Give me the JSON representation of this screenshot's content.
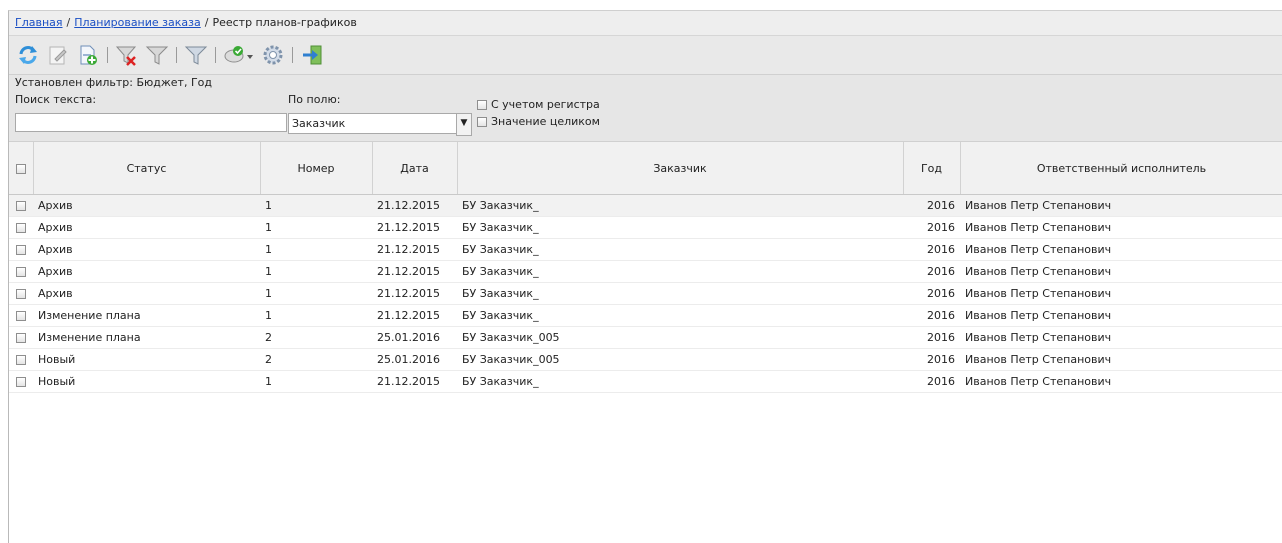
{
  "breadcrumb": {
    "home": "Главная",
    "separator": "/",
    "planning": "Планирование заказа",
    "current": "Реестр планов-графиков"
  },
  "toolbar": {
    "icons": [
      "refresh-icon",
      "edit-icon",
      "add-document-icon",
      "filter-remove-icon",
      "filter-icon",
      "filter-funnel-icon",
      "approve-dropdown-icon",
      "settings-icon",
      "exit-icon"
    ]
  },
  "filter": {
    "status": "Установлен фильтр: Бюджет, Год",
    "search_label": "Поиск текста:",
    "search_value": "",
    "field_label": "По полю:",
    "field_value": "Заказчик",
    "case_sensitive": "С учетом регистра",
    "whole_value": "Значение целиком"
  },
  "table": {
    "columns": {
      "status": "Статус",
      "number": "Номер",
      "date": "Дата",
      "customer": "Заказчик",
      "year": "Год",
      "executor": "Ответственный исполнитель"
    },
    "rows": [
      {
        "status": "Архив",
        "number": "1",
        "date": "21.12.2015",
        "customer": "БУ Заказчик_",
        "year": "2016",
        "executor": "Иванов Петр Степанович"
      },
      {
        "status": "Архив",
        "number": "1",
        "date": "21.12.2015",
        "customer": "БУ Заказчик_",
        "year": "2016",
        "executor": "Иванов Петр Степанович"
      },
      {
        "status": "Архив",
        "number": "1",
        "date": "21.12.2015",
        "customer": "БУ Заказчик_",
        "year": "2016",
        "executor": "Иванов Петр Степанович"
      },
      {
        "status": "Архив",
        "number": "1",
        "date": "21.12.2015",
        "customer": "БУ Заказчик_",
        "year": "2016",
        "executor": "Иванов Петр Степанович"
      },
      {
        "status": "Архив",
        "number": "1",
        "date": "21.12.2015",
        "customer": "БУ Заказчик_",
        "year": "2016",
        "executor": "Иванов Петр Степанович"
      },
      {
        "status": "Изменение плана",
        "number": "1",
        "date": "21.12.2015",
        "customer": "БУ Заказчик_",
        "year": "2016",
        "executor": "Иванов Петр Степанович"
      },
      {
        "status": "Изменение плана",
        "number": "2",
        "date": "25.01.2016",
        "customer": "БУ Заказчик_005",
        "year": "2016",
        "executor": "Иванов Петр Степанович"
      },
      {
        "status": "Новый",
        "number": "2",
        "date": "25.01.2016",
        "customer": "БУ Заказчик_005",
        "year": "2016",
        "executor": "Иванов Петр Степанович"
      },
      {
        "status": "Новый",
        "number": "1",
        "date": "21.12.2015",
        "customer": "БУ Заказчик_",
        "year": "2016",
        "executor": "Иванов Петр Степанович"
      }
    ]
  }
}
